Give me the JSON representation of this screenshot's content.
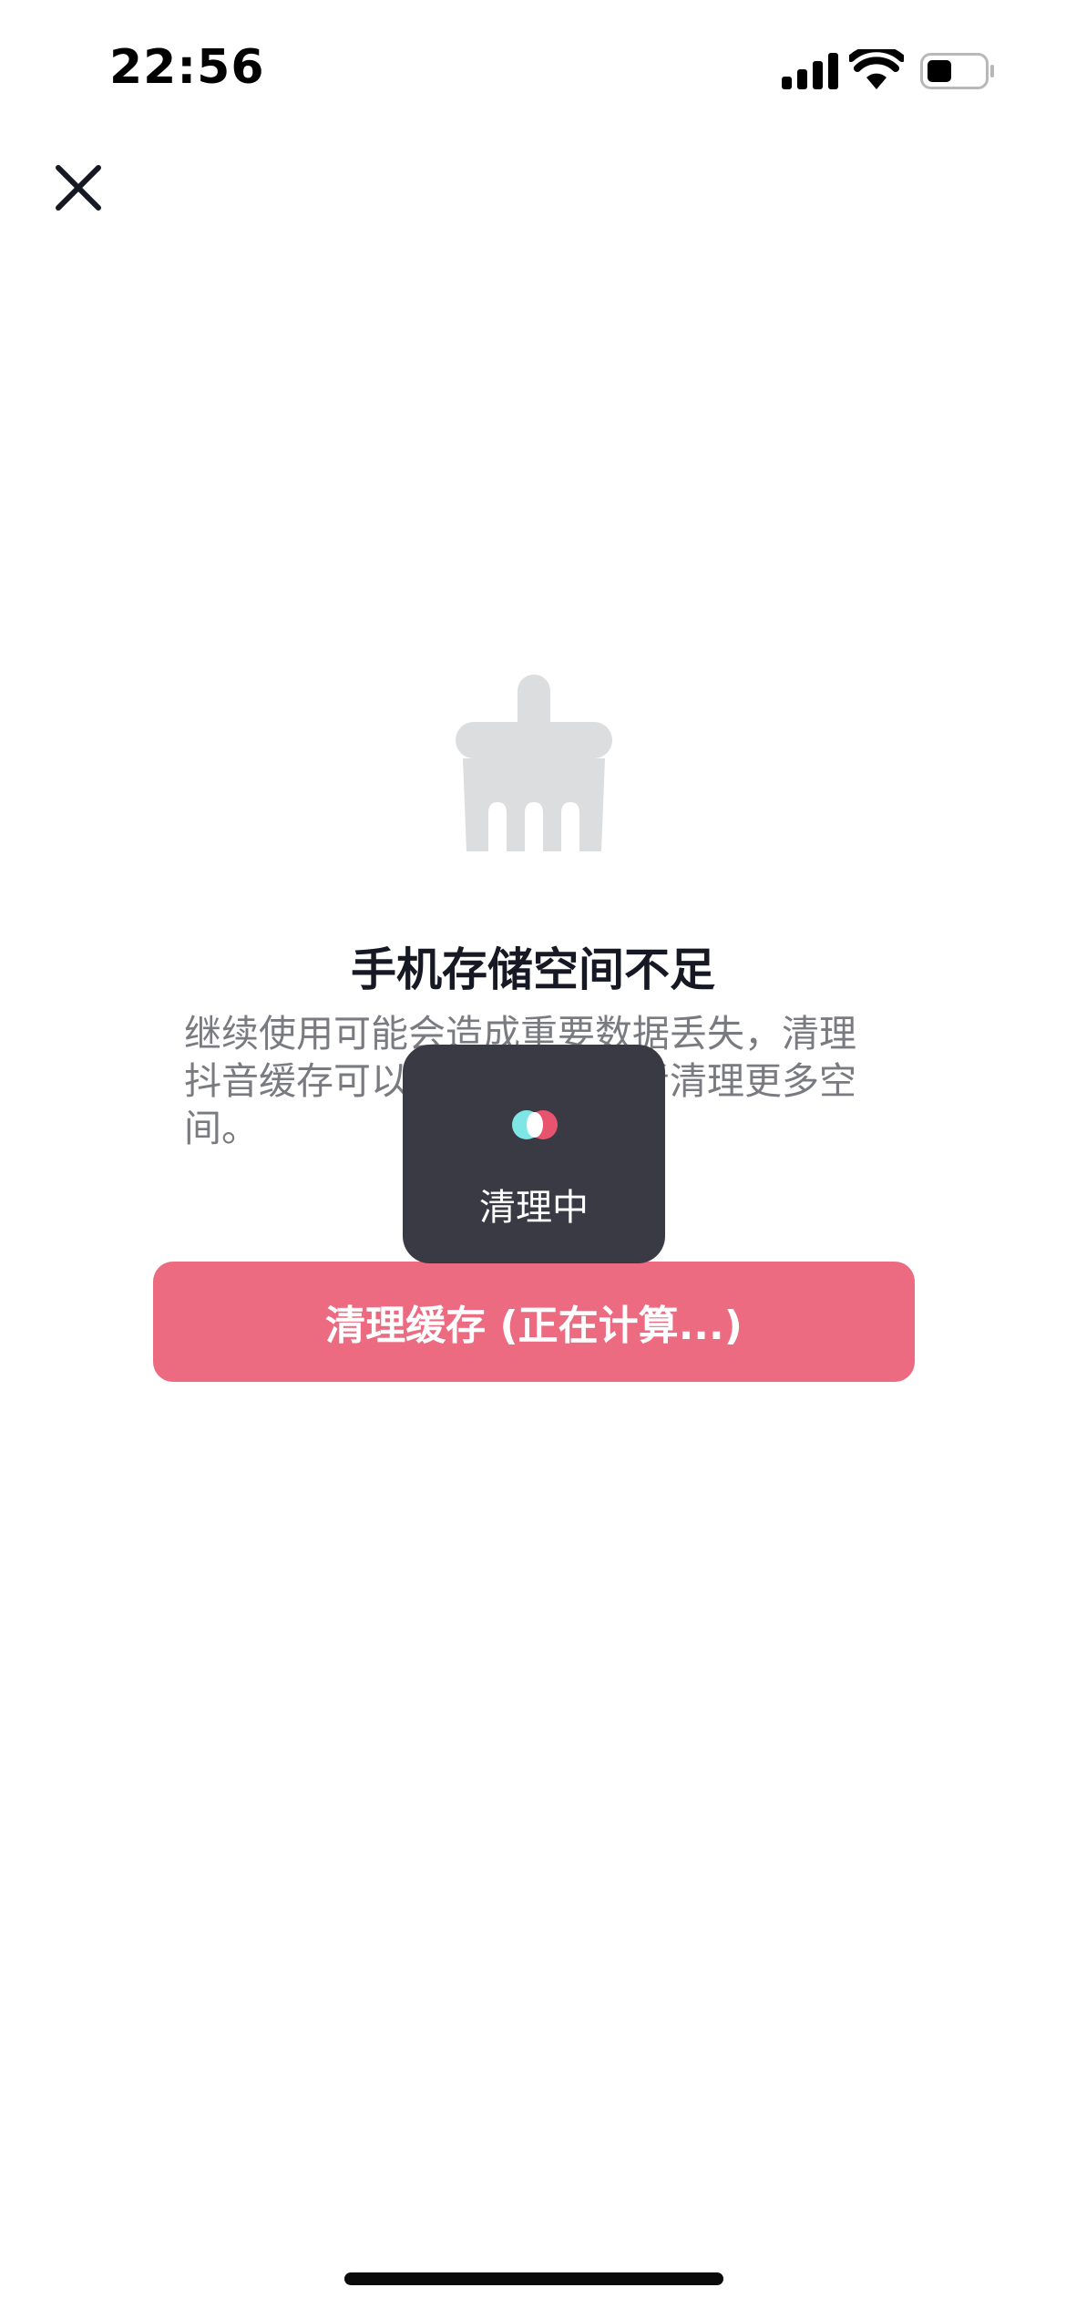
{
  "status_bar": {
    "time": "22:56",
    "icons": [
      "signal-icon",
      "wifi-icon",
      "battery-icon"
    ]
  },
  "header": {
    "close_icon": "close-icon"
  },
  "main": {
    "illustration_icon": "broom-icon",
    "title": "手机存储空间不足",
    "description": "继续使用可能会造成重要数据丢失，清理抖音缓存可以释放空间，或者清理更多空间。",
    "clean_button_label": "清理缓存 (正在计算...)"
  },
  "toast": {
    "label": "清理中",
    "loader_icon": "loading-dots-icon"
  },
  "colors": {
    "accent": "#ec6b80",
    "toast_bg": "#393a43",
    "illustration": "#dcdddf",
    "loader_cyan": "#7fe6e6",
    "loader_red": "#e8536d"
  }
}
